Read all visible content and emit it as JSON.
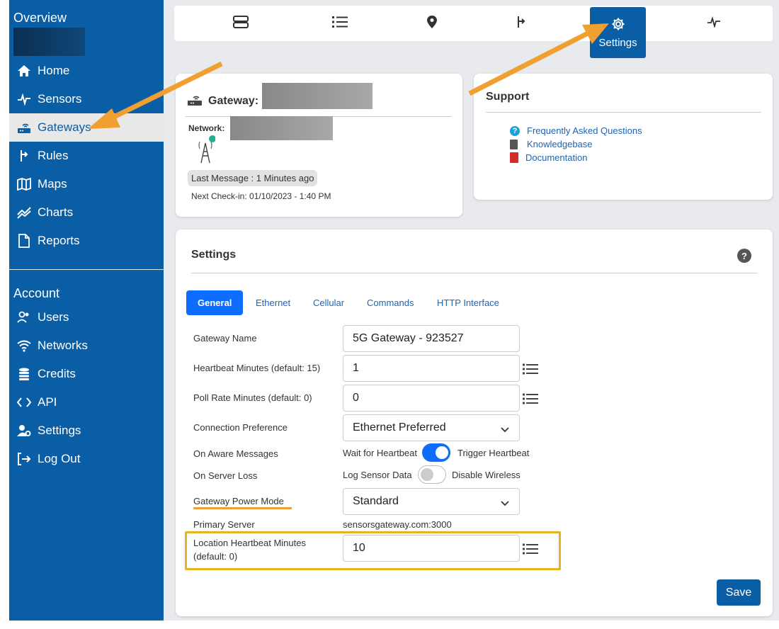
{
  "sidebar": {
    "overview_heading": "Overview",
    "account_heading": "Account",
    "items": [
      {
        "label": "Home",
        "icon": "home-icon"
      },
      {
        "label": "Sensors",
        "icon": "pulse-icon"
      },
      {
        "label": "Gateways",
        "icon": "gateway-icon"
      },
      {
        "label": "Rules",
        "icon": "rules-icon"
      },
      {
        "label": "Maps",
        "icon": "map-icon"
      },
      {
        "label": "Charts",
        "icon": "chart-icon"
      },
      {
        "label": "Reports",
        "icon": "report-icon"
      }
    ],
    "account_items": [
      {
        "label": "Users",
        "icon": "users-icon"
      },
      {
        "label": "Networks",
        "icon": "wifi-icon"
      },
      {
        "label": "Credits",
        "icon": "coins-icon"
      },
      {
        "label": "API",
        "icon": "code-icon"
      },
      {
        "label": "Settings",
        "icon": "user-gear-icon"
      },
      {
        "label": "Log Out",
        "icon": "logout-icon"
      }
    ]
  },
  "topbar": {
    "settings_label": "Settings"
  },
  "gateway_card": {
    "title": "Gateway:",
    "network_label": "Network:",
    "last_message": "Last Message : 1 Minutes ago",
    "next_checkin": "Next Check-in: 01/10/2023 - 1:40 PM"
  },
  "support": {
    "title": "Support",
    "links": [
      "Frequently Asked Questions",
      "Knowledgebase",
      "Documentation"
    ]
  },
  "settings": {
    "title": "Settings",
    "help": "?",
    "tabs": [
      "General",
      "Ethernet",
      "Cellular",
      "Commands",
      "HTTP Interface"
    ],
    "fields": {
      "gateway_name_label": "Gateway Name",
      "gateway_name_value": "5G Gateway - 923527",
      "heartbeat_label": "Heartbeat Minutes (default: 15)",
      "heartbeat_value": "1",
      "poll_label": "Poll Rate Minutes (default: 0)",
      "poll_value": "0",
      "connection_label": "Connection Preference",
      "connection_value": "Ethernet Preferred",
      "aware_label": "On Aware Messages",
      "aware_left": "Wait for Heartbeat",
      "aware_right": "Trigger Heartbeat",
      "server_loss_label": "On Server Loss",
      "server_loss_left": "Log Sensor Data",
      "server_loss_right": "Disable Wireless",
      "power_label": "Gateway Power Mode",
      "power_value": "Standard",
      "primary_label": "Primary Server",
      "primary_value": "sensorsgateway.com:3000",
      "loc_label_1": "Location Heartbeat Minutes",
      "loc_label_2": "(default: 0)",
      "loc_value": "10"
    },
    "save_label": "Save"
  },
  "colors": {
    "sidebar": "#0a5ea6",
    "accent_orange": "#f0a030",
    "highlight_box": "#e8b224",
    "tab_active": "#0d6efd"
  }
}
